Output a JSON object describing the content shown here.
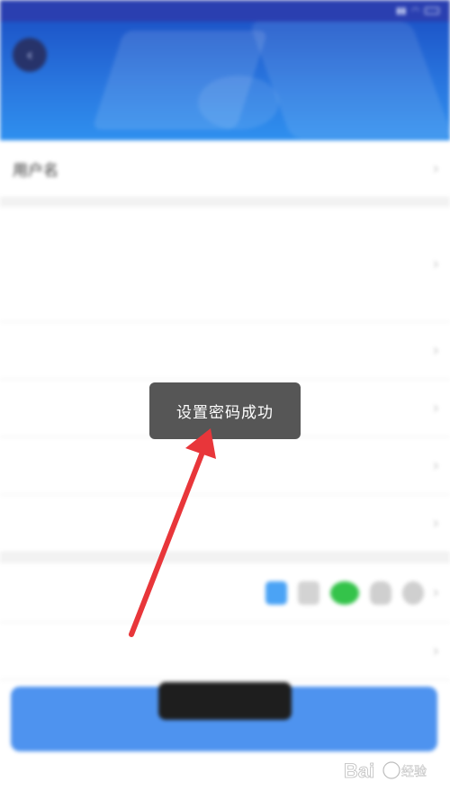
{
  "statusbar": {
    "left_text": "",
    "battery": ""
  },
  "header": {
    "title": "",
    "back_icon": "back-arrow-icon"
  },
  "rows": [
    {
      "label": "用户名",
      "value": ""
    },
    {
      "label": "",
      "value": ""
    },
    {
      "label": "",
      "value": ""
    },
    {
      "label": "",
      "value": ""
    },
    {
      "label": "",
      "value": ""
    },
    {
      "label": "",
      "value": ""
    },
    {
      "label": "",
      "value": ""
    },
    {
      "label": "",
      "value": ""
    }
  ],
  "toast": {
    "message": "设置密码成功"
  },
  "bottom_toast": {
    "message": ""
  },
  "colors": {
    "accent": "#4e93ef",
    "header": "#2a78e0",
    "annotation_arrow": "#e8363a"
  },
  "watermark": {
    "text": "Bai 经验"
  }
}
